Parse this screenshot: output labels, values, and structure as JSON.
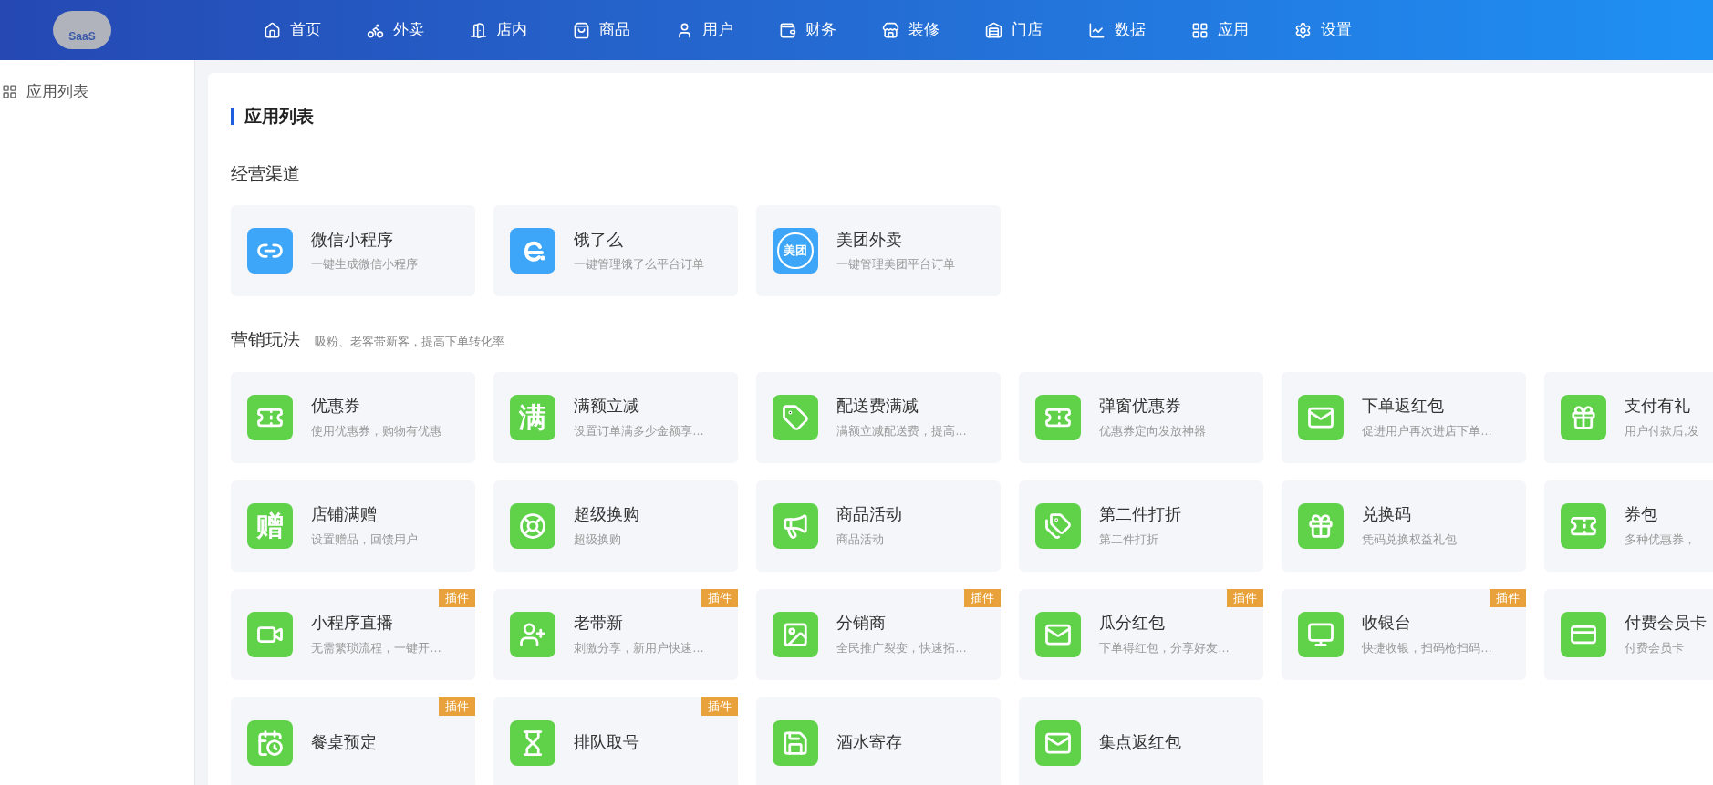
{
  "logo": {
    "text": "SaaS"
  },
  "nav": [
    {
      "label": "首页"
    },
    {
      "label": "外卖"
    },
    {
      "label": "店内"
    },
    {
      "label": "商品"
    },
    {
      "label": "用户"
    },
    {
      "label": "财务"
    },
    {
      "label": "装修"
    },
    {
      "label": "门店"
    },
    {
      "label": "数据"
    },
    {
      "label": "应用"
    },
    {
      "label": "设置"
    }
  ],
  "sidebar": {
    "items": [
      {
        "label": "应用列表"
      }
    ]
  },
  "page": {
    "title": "应用列表"
  },
  "sections": [
    {
      "kind": "channel",
      "title": "经营渠道",
      "apps": [
        {
          "name": "微信小程序",
          "desc": "一键生成微信小程序"
        },
        {
          "name": "饿了么",
          "desc": "一键管理饿了么平台订单"
        },
        {
          "name": "美团外卖",
          "desc": "一键管理美团平台订单",
          "glyph": "美团"
        }
      ]
    },
    {
      "kind": "marketing",
      "title": "营销玩法",
      "subtitle": "吸粉、老客带新客，提高下单转化率",
      "apps": [
        {
          "name": "优惠券",
          "desc": "使用优惠券，购物有优惠"
        },
        {
          "name": "满额立减",
          "desc": "设置订单满多少金额享…",
          "glyph": "满"
        },
        {
          "name": "配送费满减",
          "desc": "满额立减配送费，提高…"
        },
        {
          "name": "弹窗优惠券",
          "desc": "优惠券定向发放神器"
        },
        {
          "name": "下单返红包",
          "desc": "促进用户再次进店下单…"
        },
        {
          "name": "支付有礼",
          "desc": "用户付款后,发"
        },
        {
          "name": "店铺满赠",
          "desc": "设置赠品，回馈用户",
          "glyph": "赠"
        },
        {
          "name": "超级换购",
          "desc": "超级换购"
        },
        {
          "name": "商品活动",
          "desc": "商品活动"
        },
        {
          "name": "第二件打折",
          "desc": "第二件打折"
        },
        {
          "name": "兑换码",
          "desc": "凭码兑换权益礼包"
        },
        {
          "name": "券包",
          "desc": "多种优惠券，"
        },
        {
          "name": "小程序直播",
          "desc": "无需繁琐流程，一键开…",
          "badge": "插件"
        },
        {
          "name": "老带新",
          "desc": "刺激分享，新用户快速…",
          "badge": "插件"
        },
        {
          "name": "分销商",
          "desc": "全民推广裂变，快速拓…",
          "badge": "插件"
        },
        {
          "name": "瓜分红包",
          "desc": "下单得红包，分享好友…",
          "badge": "插件"
        },
        {
          "name": "收银台",
          "desc": "快捷收银，扫码枪扫码…",
          "badge": "插件"
        },
        {
          "name": "付费会员卡",
          "desc": "付费会员卡"
        },
        {
          "name": "餐桌预定",
          "badge": "插件"
        },
        {
          "name": "排队取号",
          "badge": "插件"
        },
        {
          "name": "酒水寄存"
        },
        {
          "name": "集点返红包"
        }
      ]
    }
  ]
}
